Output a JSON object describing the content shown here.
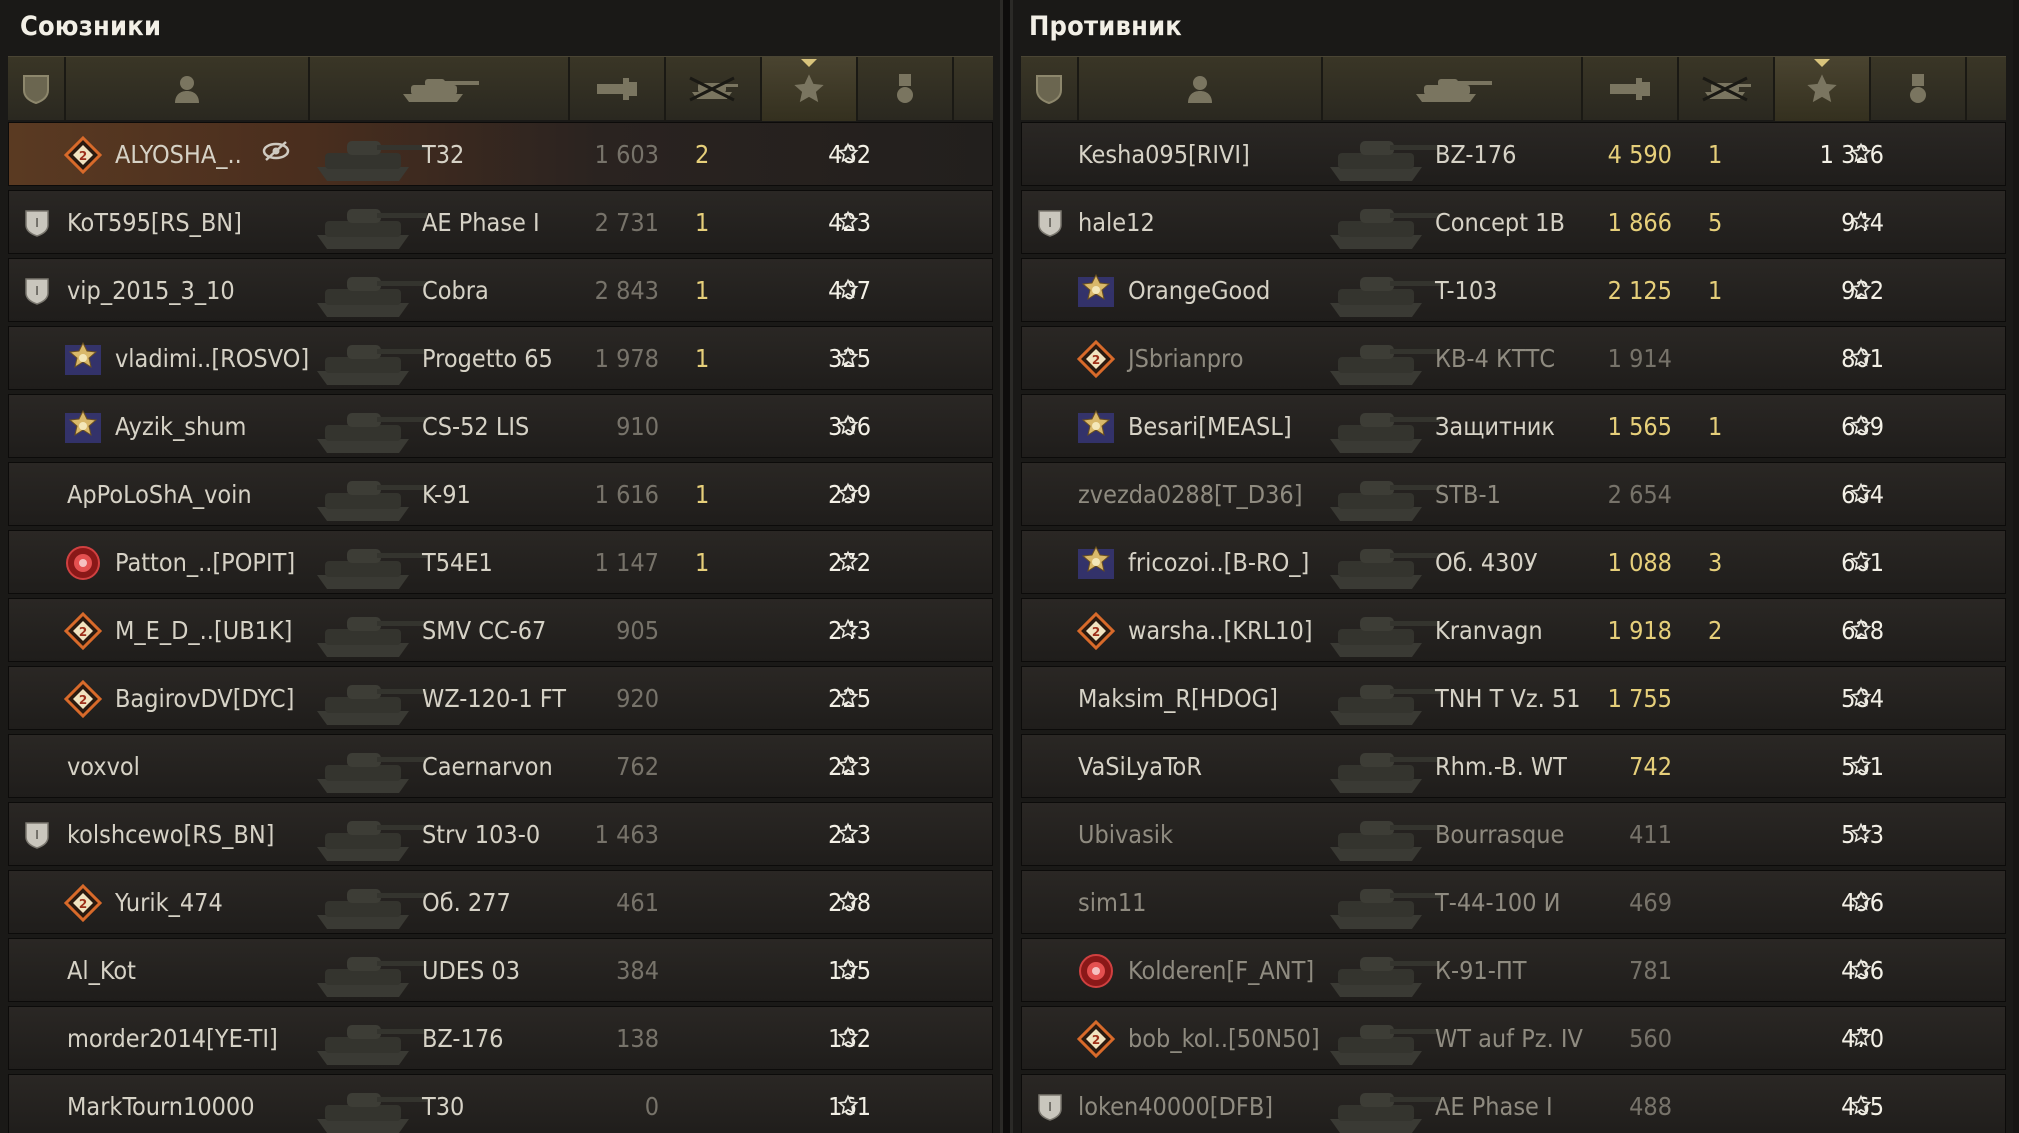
{
  "allies": {
    "title": "Союзники",
    "rows": [
      {
        "name": "ALYOSHA_..",
        "tank": "T32",
        "damage": "1 603",
        "kills": "2",
        "xp": "482",
        "badge": false,
        "icon": "diamond-orange",
        "me": true
      },
      {
        "name": "KoT595[RS_BN]",
        "tank": "AE Phase I",
        "damage": "2 731",
        "kills": "1",
        "xp": "423",
        "badge": true,
        "icon": ""
      },
      {
        "name": "vip_2015_3_10",
        "tank": "Cobra",
        "damage": "2 843",
        "kills": "1",
        "xp": "407",
        "badge": true,
        "icon": ""
      },
      {
        "name": "vladimi..[ROSVO]",
        "tank": "Progetto 65",
        "damage": "1 978",
        "kills": "1",
        "xp": "325",
        "badge": false,
        "icon": "emblem-gold"
      },
      {
        "name": "Ayzik_shum",
        "tank": "CS-52 LIS",
        "damage": "910",
        "kills": "",
        "xp": "306",
        "badge": false,
        "icon": "emblem-gold"
      },
      {
        "name": "ApPoLoShA_voin",
        "tank": "K-91",
        "damage": "1 616",
        "kills": "1",
        "xp": "299",
        "badge": false,
        "icon": ""
      },
      {
        "name": "Patton_..[POPIT]",
        "tank": "T54E1",
        "damage": "1 147",
        "kills": "1",
        "xp": "272",
        "badge": false,
        "icon": "emblem-red"
      },
      {
        "name": "M_E_D_..[UB1K]",
        "tank": "SMV CC-67",
        "damage": "905",
        "kills": "",
        "xp": "243",
        "badge": false,
        "icon": "diamond-orange"
      },
      {
        "name": "BagirovDV[DYC]",
        "tank": "WZ-120-1 FT",
        "damage": "920",
        "kills": "",
        "xp": "225",
        "badge": false,
        "icon": "diamond-orange"
      },
      {
        "name": "voxvol",
        "tank": "Caernarvon",
        "damage": "762",
        "kills": "",
        "xp": "223",
        "badge": false,
        "icon": ""
      },
      {
        "name": "kolshcewo[RS_BN]",
        "tank": "Strv 103-0",
        "damage": "1 463",
        "kills": "",
        "xp": "213",
        "badge": true,
        "icon": ""
      },
      {
        "name": "Yurik_474",
        "tank": "Об. 277",
        "damage": "461",
        "kills": "",
        "xp": "208",
        "badge": false,
        "icon": "diamond-orange"
      },
      {
        "name": "Al_Kot",
        "tank": "UDES 03",
        "damage": "384",
        "kills": "",
        "xp": "195",
        "badge": false,
        "icon": ""
      },
      {
        "name": "morder2014[YE-TI]",
        "tank": "BZ-176",
        "damage": "138",
        "kills": "",
        "xp": "182",
        "badge": false,
        "icon": ""
      },
      {
        "name": "MarkTourn10000",
        "tank": "T30",
        "damage": "0",
        "kills": "",
        "xp": "161",
        "badge": false,
        "icon": ""
      }
    ]
  },
  "enemies": {
    "title": "Противник",
    "rows": [
      {
        "name": "Kesha095[RIVI]",
        "tank": "BZ-176",
        "damage": "4 590",
        "kills": "1",
        "xp": "1 326",
        "badge": false,
        "icon": "",
        "hi": true
      },
      {
        "name": "hale12",
        "tank": "Concept 1B",
        "damage": "1 866",
        "kills": "5",
        "xp": "944",
        "badge": true,
        "icon": "",
        "hi": true
      },
      {
        "name": "OrangeGood",
        "tank": "T-103",
        "damage": "2 125",
        "kills": "1",
        "xp": "922",
        "badge": false,
        "icon": "emblem-gold",
        "hi": true
      },
      {
        "name": "JSbrianpro",
        "tank": "КВ-4 КТТС",
        "damage": "1 914",
        "kills": "",
        "xp": "801",
        "badge": false,
        "icon": "diamond-orange",
        "dead": true
      },
      {
        "name": "Besari[MEASL]",
        "tank": "Защитник",
        "damage": "1 565",
        "kills": "1",
        "xp": "689",
        "badge": false,
        "icon": "emblem-gold",
        "hi": true
      },
      {
        "name": "zvezda0288[T_D36]",
        "tank": "STB-1",
        "damage": "2 654",
        "kills": "",
        "xp": "664",
        "badge": false,
        "icon": "",
        "dead": true
      },
      {
        "name": "fricozoi..[B-RO_]",
        "tank": "Об. 430У",
        "damage": "1 088",
        "kills": "3",
        "xp": "661",
        "badge": false,
        "icon": "emblem-gold",
        "hi": true
      },
      {
        "name": "warsha..[KRL10]",
        "tank": "Kranvagn",
        "damage": "1 918",
        "kills": "2",
        "xp": "628",
        "badge": false,
        "icon": "diamond-orange",
        "hi": true
      },
      {
        "name": "Maksim_R[HDOG]",
        "tank": "TNH T Vz. 51",
        "damage": "1 755",
        "kills": "",
        "xp": "584",
        "badge": false,
        "icon": "",
        "hi": true
      },
      {
        "name": "VaSiLyaToR",
        "tank": "Rhm.-B. WT",
        "damage": "742",
        "kills": "",
        "xp": "561",
        "badge": false,
        "icon": "",
        "hi": true
      },
      {
        "name": "Ubivasik",
        "tank": "Bourrasque",
        "damage": "411",
        "kills": "",
        "xp": "543",
        "badge": false,
        "icon": "",
        "dead": true
      },
      {
        "name": "sim11",
        "tank": "Т-44-100 И",
        "damage": "469",
        "kills": "",
        "xp": "496",
        "badge": false,
        "icon": "",
        "dead": true
      },
      {
        "name": "Kolderen[F_ANT]",
        "tank": "К-91-ПТ",
        "damage": "781",
        "kills": "",
        "xp": "486",
        "badge": false,
        "icon": "emblem-red",
        "dead": true
      },
      {
        "name": "bob_kol..[50N50]",
        "tank": "WT auf Pz. IV",
        "damage": "560",
        "kills": "",
        "xp": "470",
        "badge": false,
        "icon": "diamond-orange",
        "dead": true
      },
      {
        "name": "loken40000[DFB]",
        "tank": "AE Phase I",
        "damage": "488",
        "kills": "",
        "xp": "465",
        "badge": true,
        "icon": "",
        "dead": true
      }
    ]
  },
  "columns": [
    "platoon-icon",
    "player-icon",
    "tank-icon",
    "damage-icon",
    "kills-icon",
    "xp-star-icon",
    "medal-icon"
  ],
  "colors": {
    "gold": "#e6cf7a",
    "dim": "#77736a",
    "white": "#f3f0e6"
  }
}
